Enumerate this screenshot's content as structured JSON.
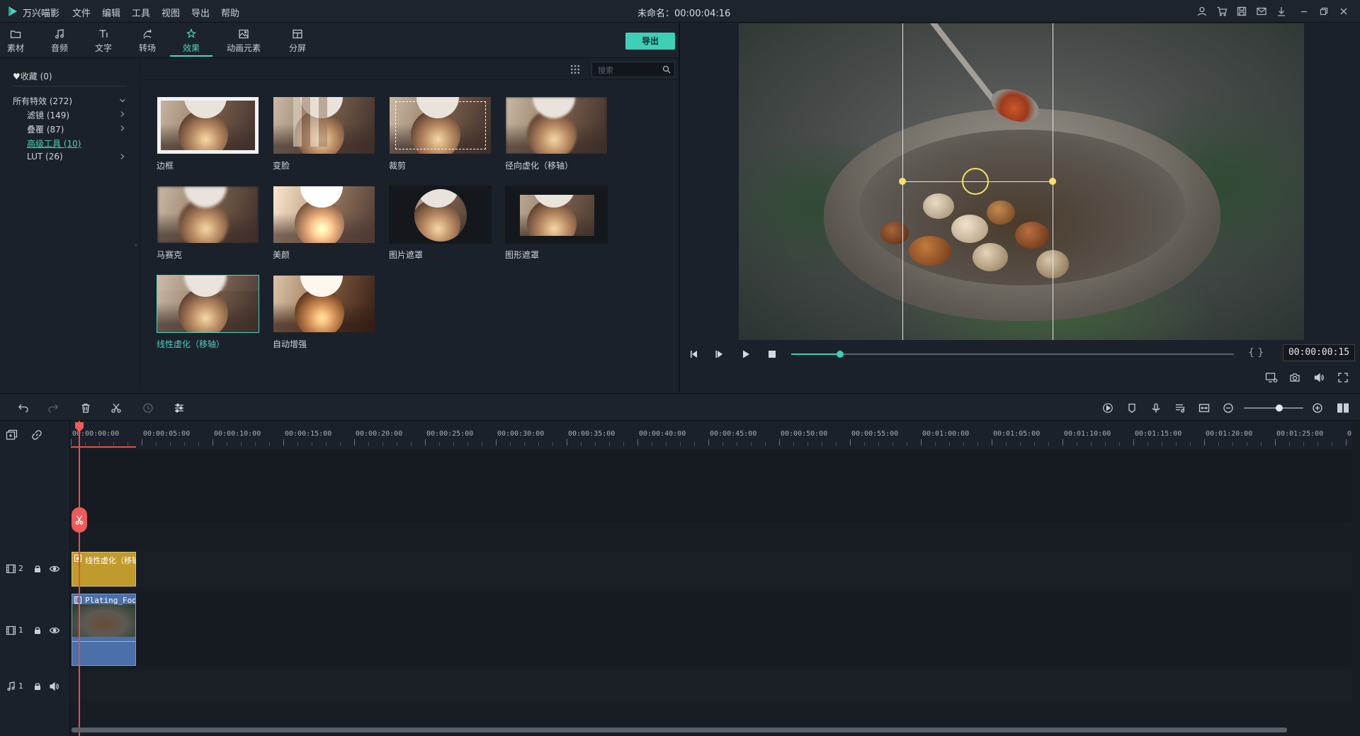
{
  "titlebar": {
    "app_name": "万兴喵影",
    "menus": [
      "文件",
      "编辑",
      "工具",
      "视图",
      "导出",
      "帮助"
    ],
    "project_title": "未命名：00:00:04:16",
    "icons": [
      "user-icon",
      "cart-icon",
      "save-icon",
      "mail-icon",
      "download-icon",
      "minimize-icon",
      "restore-icon",
      "close-icon"
    ]
  },
  "library": {
    "tabs": [
      {
        "label": "素材",
        "icon": "folder-icon"
      },
      {
        "label": "音频",
        "icon": "music-icon"
      },
      {
        "label": "文字",
        "icon": "text-icon"
      },
      {
        "label": "转场",
        "icon": "transition-icon"
      },
      {
        "label": "效果",
        "icon": "effects-icon"
      },
      {
        "label": "动画元素",
        "icon": "image-icon"
      },
      {
        "label": "分屏",
        "icon": "split-screen-icon"
      }
    ],
    "active_tab": "效果",
    "export_label": "导出",
    "search_placeholder": "搜索",
    "categories": {
      "favorites": "收藏 (0)",
      "all": "所有特效 (272)",
      "filters": "滤镜 (149)",
      "overlays": "叠覆 (87)",
      "advanced": "高级工具 (10)",
      "lut": "LUT (26)"
    },
    "effects": [
      {
        "label": "边框"
      },
      {
        "label": "变脸"
      },
      {
        "label": "裁剪"
      },
      {
        "label": "径向虚化（移轴）"
      },
      {
        "label": "马赛克"
      },
      {
        "label": "美颜"
      },
      {
        "label": "图片遮罩"
      },
      {
        "label": "图形遮罩"
      },
      {
        "label": "线性虚化（移轴）"
      },
      {
        "label": "自动增强"
      }
    ],
    "selected_effect": "线性虚化（移轴）"
  },
  "preview": {
    "timecode": "00:00:00:15",
    "progress": 0.11,
    "brackets": "{ }"
  },
  "timeline": {
    "ruler_labels": [
      "00:00:00:00",
      "00:00:05:00",
      "00:00:10:00",
      "00:00:15:00",
      "00:00:20:00",
      "00:00:25:00",
      "00:00:30:00",
      "00:00:35:00",
      "00:00:40:00",
      "00:00:45:00",
      "00:00:50:00",
      "00:00:55:00",
      "00:01:00:00",
      "00:01:05:00",
      "00:01:10:00",
      "00:01:15:00",
      "00:01:20:00",
      "00:01:25:00",
      "0"
    ],
    "tracks": [
      {
        "type": "video",
        "number": "2"
      },
      {
        "type": "video",
        "number": "1"
      },
      {
        "type": "audio",
        "number": "1"
      }
    ],
    "clips": {
      "effect_clip": "线性虚化（移轴）",
      "video_clip": "Plating_Food"
    },
    "zoom": 0.6
  }
}
